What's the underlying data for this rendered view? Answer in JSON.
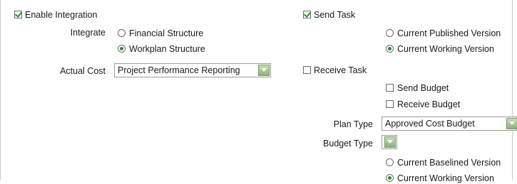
{
  "integration": {
    "enable_label": "Enable Integration",
    "enable_checked": true,
    "integrate_label": "Integrate",
    "integrate_options": [
      "Financial Structure",
      "Workplan Structure"
    ],
    "integrate_selected": "Workplan Structure",
    "actual_cost_label": "Actual Cost",
    "actual_cost_value": "Project Performance Reporting"
  },
  "send_task": {
    "label": "Send Task",
    "checked": true,
    "version_options": [
      "Current Published Version",
      "Current Working Version"
    ],
    "version_selected": "Current Working Version"
  },
  "receive_task": {
    "label": "Receive Task",
    "checked": false,
    "send_budget_label": "Send Budget",
    "send_budget_checked": false,
    "receive_budget_label": "Receive Budget",
    "receive_budget_checked": false,
    "plan_type_label": "Plan Type",
    "plan_type_value": "Approved Cost Budget",
    "budget_type_label": "Budget Type",
    "budget_type_value": "",
    "version_options": [
      "Current Baselined Version",
      "Current Working Version"
    ],
    "version_selected": "Current Working Version"
  },
  "colors": {
    "accent_green": "#2f8a2f",
    "dropdown_button": "#9bbb86",
    "border": "#9a9a9a"
  },
  "icons": {
    "dropdown": "chevron-down-icon",
    "check": "check-icon",
    "radio": "radio-dot-icon"
  }
}
